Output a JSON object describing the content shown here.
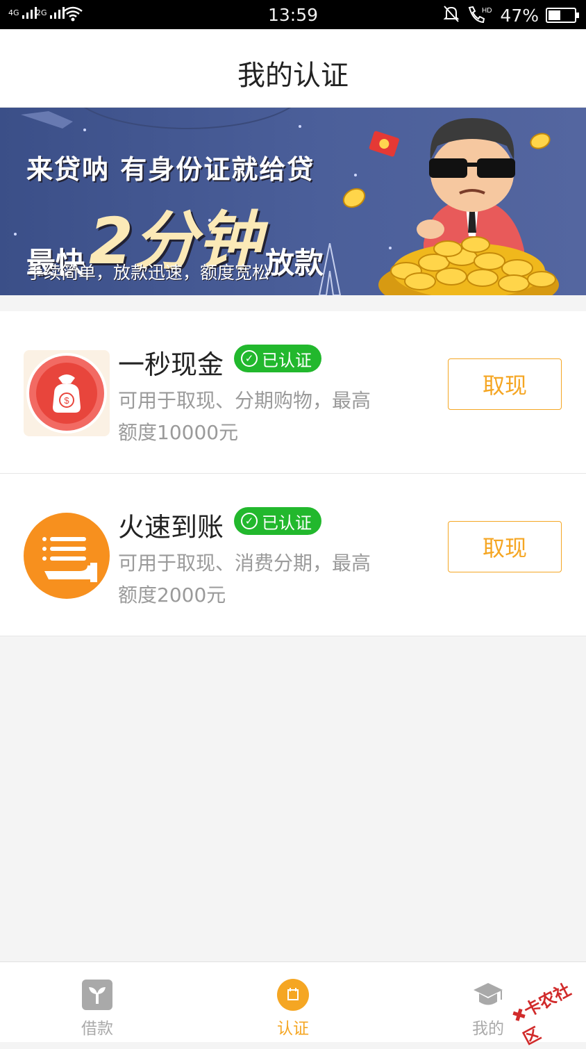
{
  "status_bar": {
    "signal_1": "4G",
    "signal_2": "2G",
    "time": "13:59",
    "battery_pct": "47%",
    "battery_level": 0.47
  },
  "header": {
    "title": "我的认证"
  },
  "banner": {
    "line1": "来贷呐 有身份证就给贷",
    "line2_pre": "最快",
    "line2_big": "2分钟",
    "line2_post": "放款",
    "line3": "手续简单，放款迅速，额度宽松"
  },
  "cards": [
    {
      "name": "一秒现金",
      "badge": "已认证",
      "desc": "可用于取现、分期购物，最高额度10000元",
      "button": "取现",
      "logo_icon": "money-bag-icon"
    },
    {
      "name": "火速到账",
      "badge": "已认证",
      "desc": "可用于取现、消费分期，最高额度2000元",
      "button": "取现",
      "logo_icon": "hand-list-icon"
    }
  ],
  "tabbar": {
    "tabs": [
      {
        "label": "借款",
        "icon": "sprout-icon",
        "active": false
      },
      {
        "label": "认证",
        "icon": "certify-icon",
        "active": true
      },
      {
        "label": "我的",
        "icon": "graduation-cap-icon",
        "active": false
      }
    ]
  },
  "watermark": "卡农社区",
  "colors": {
    "accent": "#f5a623",
    "verified_green": "#22b82d",
    "banner_blue": "#4b5f9a",
    "logo_red": "#e8453c",
    "logo_orange": "#f7901e"
  }
}
